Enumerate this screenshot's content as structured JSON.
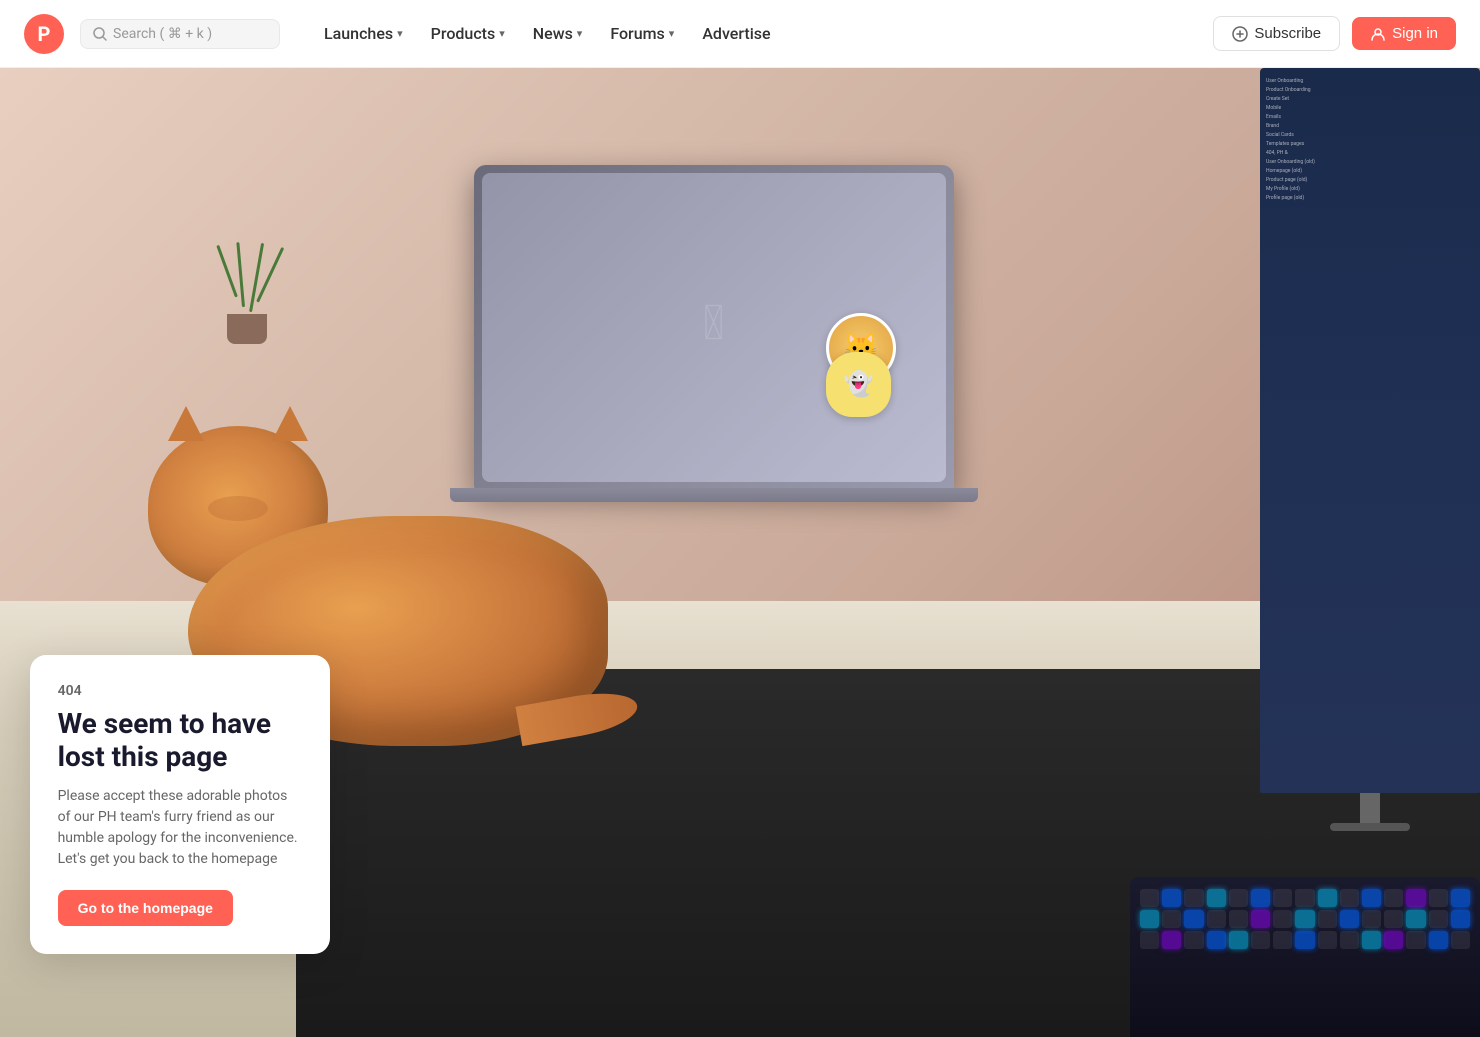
{
  "navbar": {
    "logo_letter": "P",
    "search_placeholder": "Search ( ⌘ + k )",
    "nav_items": [
      {
        "label": "Launches",
        "has_dropdown": true
      },
      {
        "label": "Products",
        "has_dropdown": true
      },
      {
        "label": "News",
        "has_dropdown": true
      },
      {
        "label": "Forums",
        "has_dropdown": true
      },
      {
        "label": "Advertise",
        "has_dropdown": false
      }
    ],
    "subscribe_label": "Subscribe",
    "signin_label": "Sign in"
  },
  "error_page": {
    "code": "404",
    "title": "We seem to have lost this page",
    "description": "Please accept these adorable photos of our PH team's furry friend as our humble apology for the inconvenience. Let's get you back to the homepage",
    "cta_label": "Go to the homepage"
  },
  "monitor_lines": [
    "User Onboarding",
    "Product Onboarding",
    "Create Set",
    "Mobile",
    "Emails",
    "Brand",
    "Social Cards",
    "Templates pages",
    "404, PH &",
    "User Onboarding (old)",
    "Homepage (old)",
    "Product page (old)",
    "My Profile (old)",
    "Profile page (old)"
  ],
  "colors": {
    "brand_red": "#ff6154",
    "nav_bg": "#ffffff",
    "error_card_bg": "#ffffff",
    "text_dark": "#1a1a2e",
    "text_muted": "#666666"
  }
}
